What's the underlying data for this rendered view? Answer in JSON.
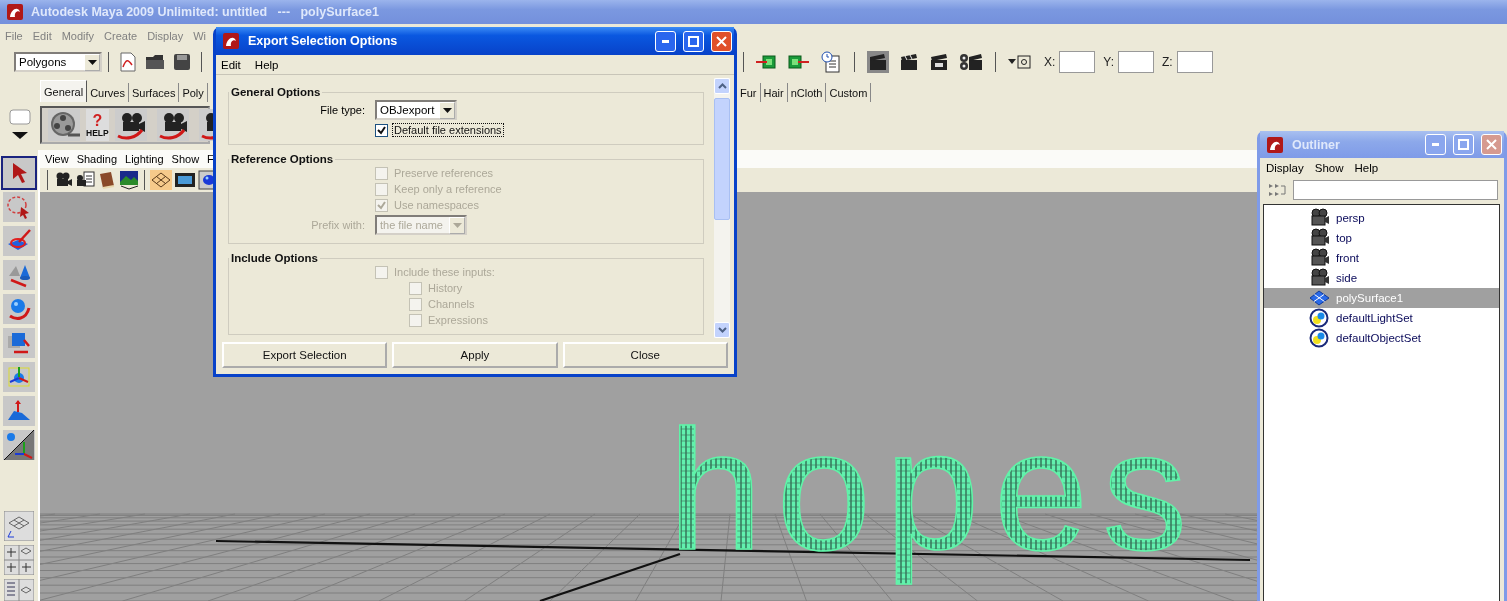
{
  "window": {
    "title": "Autodesk Maya 2009 Unlimited: untitled   ---   polySurface1"
  },
  "menu_bar": [
    "File",
    "Edit",
    "Modify",
    "Create",
    "Display",
    "Wi"
  ],
  "status_line": {
    "mode": "Polygons",
    "coordinate_fields": [
      {
        "label": "X:"
      },
      {
        "label": "Y:"
      },
      {
        "label": "Z:"
      }
    ]
  },
  "shelf": {
    "tabs_left": [
      {
        "label": "General",
        "selected": true
      },
      {
        "label": "Curves",
        "selected": false
      },
      {
        "label": "Surfaces",
        "selected": false
      },
      {
        "label": "Poly",
        "selected": false
      }
    ],
    "tabs_right": [
      {
        "label": "Fur",
        "selected": false
      },
      {
        "label": "Hair",
        "selected": false
      },
      {
        "label": "nCloth",
        "selected": false
      },
      {
        "label": "Custom",
        "selected": false
      }
    ],
    "help_mark": "?",
    "help_label": "HELP"
  },
  "viewport": {
    "menus": [
      "View",
      "Shading",
      "Lighting",
      "Show",
      "F"
    ],
    "model_text": "hopes"
  },
  "dialog": {
    "title": "Export Selection Options",
    "menus": [
      "Edit",
      "Help"
    ],
    "sections": [
      {
        "title": "General Options",
        "rows": [
          {
            "kind": "dropdown",
            "label": "File type:",
            "value": "OBJexport",
            "disabled": false
          },
          {
            "kind": "checkbox",
            "label": "Default file extensions",
            "checked": true,
            "disabled": false,
            "focused": true
          }
        ]
      },
      {
        "title": "Reference Options",
        "rows": [
          {
            "kind": "checkbox",
            "label": "Preserve references",
            "checked": false,
            "disabled": true,
            "focused": false
          },
          {
            "kind": "checkbox",
            "label": "Keep only a reference",
            "checked": false,
            "disabled": true,
            "focused": false
          },
          {
            "kind": "checkbox",
            "label": "Use namespaces",
            "checked": true,
            "disabled": true,
            "focused": false
          },
          {
            "kind": "dropdown",
            "label": "Prefix with:",
            "value": "the file name",
            "disabled": true
          }
        ]
      },
      {
        "title": "Include Options",
        "rows": [
          {
            "kind": "checkbox",
            "label": "Include these inputs:",
            "checked": false,
            "disabled": true,
            "focused": false,
            "children": [
              {
                "kind": "checkbox",
                "label": "History",
                "checked": false,
                "disabled": true,
                "focused": false
              },
              {
                "kind": "checkbox",
                "label": "Channels",
                "checked": false,
                "disabled": true,
                "focused": false
              },
              {
                "kind": "checkbox",
                "label": "Expressions",
                "checked": false,
                "disabled": true,
                "focused": false
              }
            ]
          }
        ]
      }
    ],
    "buttons": [
      "Export Selection",
      "Apply",
      "Close"
    ]
  },
  "outliner": {
    "title": "Outliner",
    "menus": [
      "Display",
      "Show",
      "Help"
    ],
    "items": [
      {
        "label": "persp",
        "kind": "camera",
        "selected": false
      },
      {
        "label": "top",
        "kind": "camera",
        "selected": false
      },
      {
        "label": "front",
        "kind": "camera",
        "selected": false
      },
      {
        "label": "side",
        "kind": "camera",
        "selected": false
      },
      {
        "label": "polySurface1",
        "kind": "mesh",
        "selected": true
      },
      {
        "label": "defaultLightSet",
        "kind": "set",
        "selected": false
      },
      {
        "label": "defaultObjectSet",
        "kind": "set",
        "selected": false
      }
    ]
  }
}
